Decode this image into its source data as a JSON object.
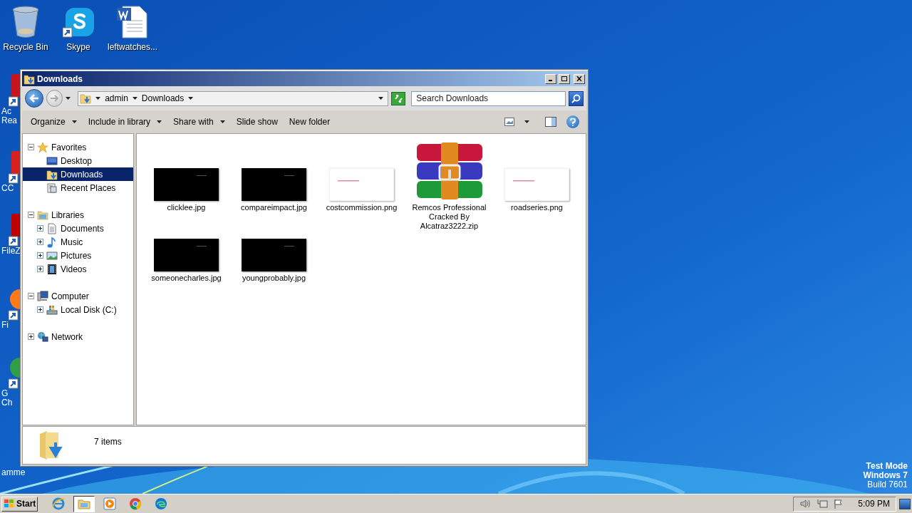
{
  "desktop": {
    "icons": [
      {
        "label": "Recycle Bin",
        "kind": "recycle"
      },
      {
        "label": "Skype",
        "kind": "skype"
      },
      {
        "label": "leftwatches...",
        "kind": "word"
      }
    ],
    "hidden_icons": [
      {
        "lines": [
          "Ac",
          "Rea"
        ],
        "kind": "acrobat"
      },
      {
        "lines": [
          "CC"
        ],
        "kind": "ccleaner"
      },
      {
        "lines": [
          "FileZ"
        ],
        "kind": "filezilla"
      },
      {
        "lines": [
          "Fi"
        ],
        "kind": "firefox"
      },
      {
        "lines": [
          "G",
          "Ch"
        ],
        "kind": "chrome"
      },
      {
        "lines": [
          "amme"
        ],
        "kind": "none"
      }
    ],
    "os_notice": [
      "Test Mode",
      "Windows 7",
      "Build 7601"
    ]
  },
  "window": {
    "title": "Downloads",
    "breadcrumb": [
      "admin",
      "Downloads"
    ],
    "search": {
      "placeholder": "Search Downloads"
    },
    "toolbar": [
      {
        "label": "Organize",
        "menu": true
      },
      {
        "label": "Include in library",
        "menu": true
      },
      {
        "label": "Share with",
        "menu": true
      },
      {
        "label": "Slide show",
        "menu": false
      },
      {
        "label": "New folder",
        "menu": false
      }
    ],
    "tree": [
      {
        "label": "Favorites",
        "kind": "star",
        "expanded": true,
        "selected": false,
        "children": [
          {
            "label": "Desktop",
            "kind": "desktop",
            "selected": false
          },
          {
            "label": "Downloads",
            "kind": "downloads",
            "selected": true
          },
          {
            "label": "Recent Places",
            "kind": "recent",
            "selected": false
          }
        ]
      },
      {
        "label": "Libraries",
        "kind": "library",
        "expanded": true,
        "selected": false,
        "children": [
          {
            "label": "Documents",
            "kind": "documents",
            "expanded": false,
            "selected": false
          },
          {
            "label": "Music",
            "kind": "music",
            "expanded": false,
            "selected": false
          },
          {
            "label": "Pictures",
            "kind": "pictures",
            "expanded": false,
            "selected": false
          },
          {
            "label": "Videos",
            "kind": "videos",
            "expanded": false,
            "selected": false
          }
        ]
      },
      {
        "label": "Computer",
        "kind": "computer",
        "expanded": true,
        "selected": false,
        "children": [
          {
            "label": "Local Disk (C:)",
            "kind": "disk",
            "expanded": false,
            "selected": false
          }
        ]
      },
      {
        "label": "Network",
        "kind": "network",
        "expanded": false,
        "selected": false
      }
    ],
    "files": [
      {
        "name": "clicklee.jpg",
        "kind": "dark"
      },
      {
        "name": "compareimpact.jpg",
        "kind": "dark"
      },
      {
        "name": "costcommission.png",
        "kind": "light"
      },
      {
        "name": "Remcos Professional Cracked By Alcatraz3222.zip",
        "kind": "archive"
      },
      {
        "name": "roadseries.png",
        "kind": "light"
      },
      {
        "name": "someonecharles.jpg",
        "kind": "dark"
      },
      {
        "name": "youngprobably.jpg",
        "kind": "dark"
      }
    ],
    "status": "7 items"
  },
  "taskbar": {
    "start": "Start",
    "apps": [
      {
        "kind": "ie",
        "active": false
      },
      {
        "kind": "explorer",
        "active": true
      },
      {
        "kind": "media",
        "active": false
      },
      {
        "kind": "chrome",
        "active": false
      },
      {
        "kind": "edge",
        "active": false
      }
    ],
    "clock": "5:09 PM"
  }
}
